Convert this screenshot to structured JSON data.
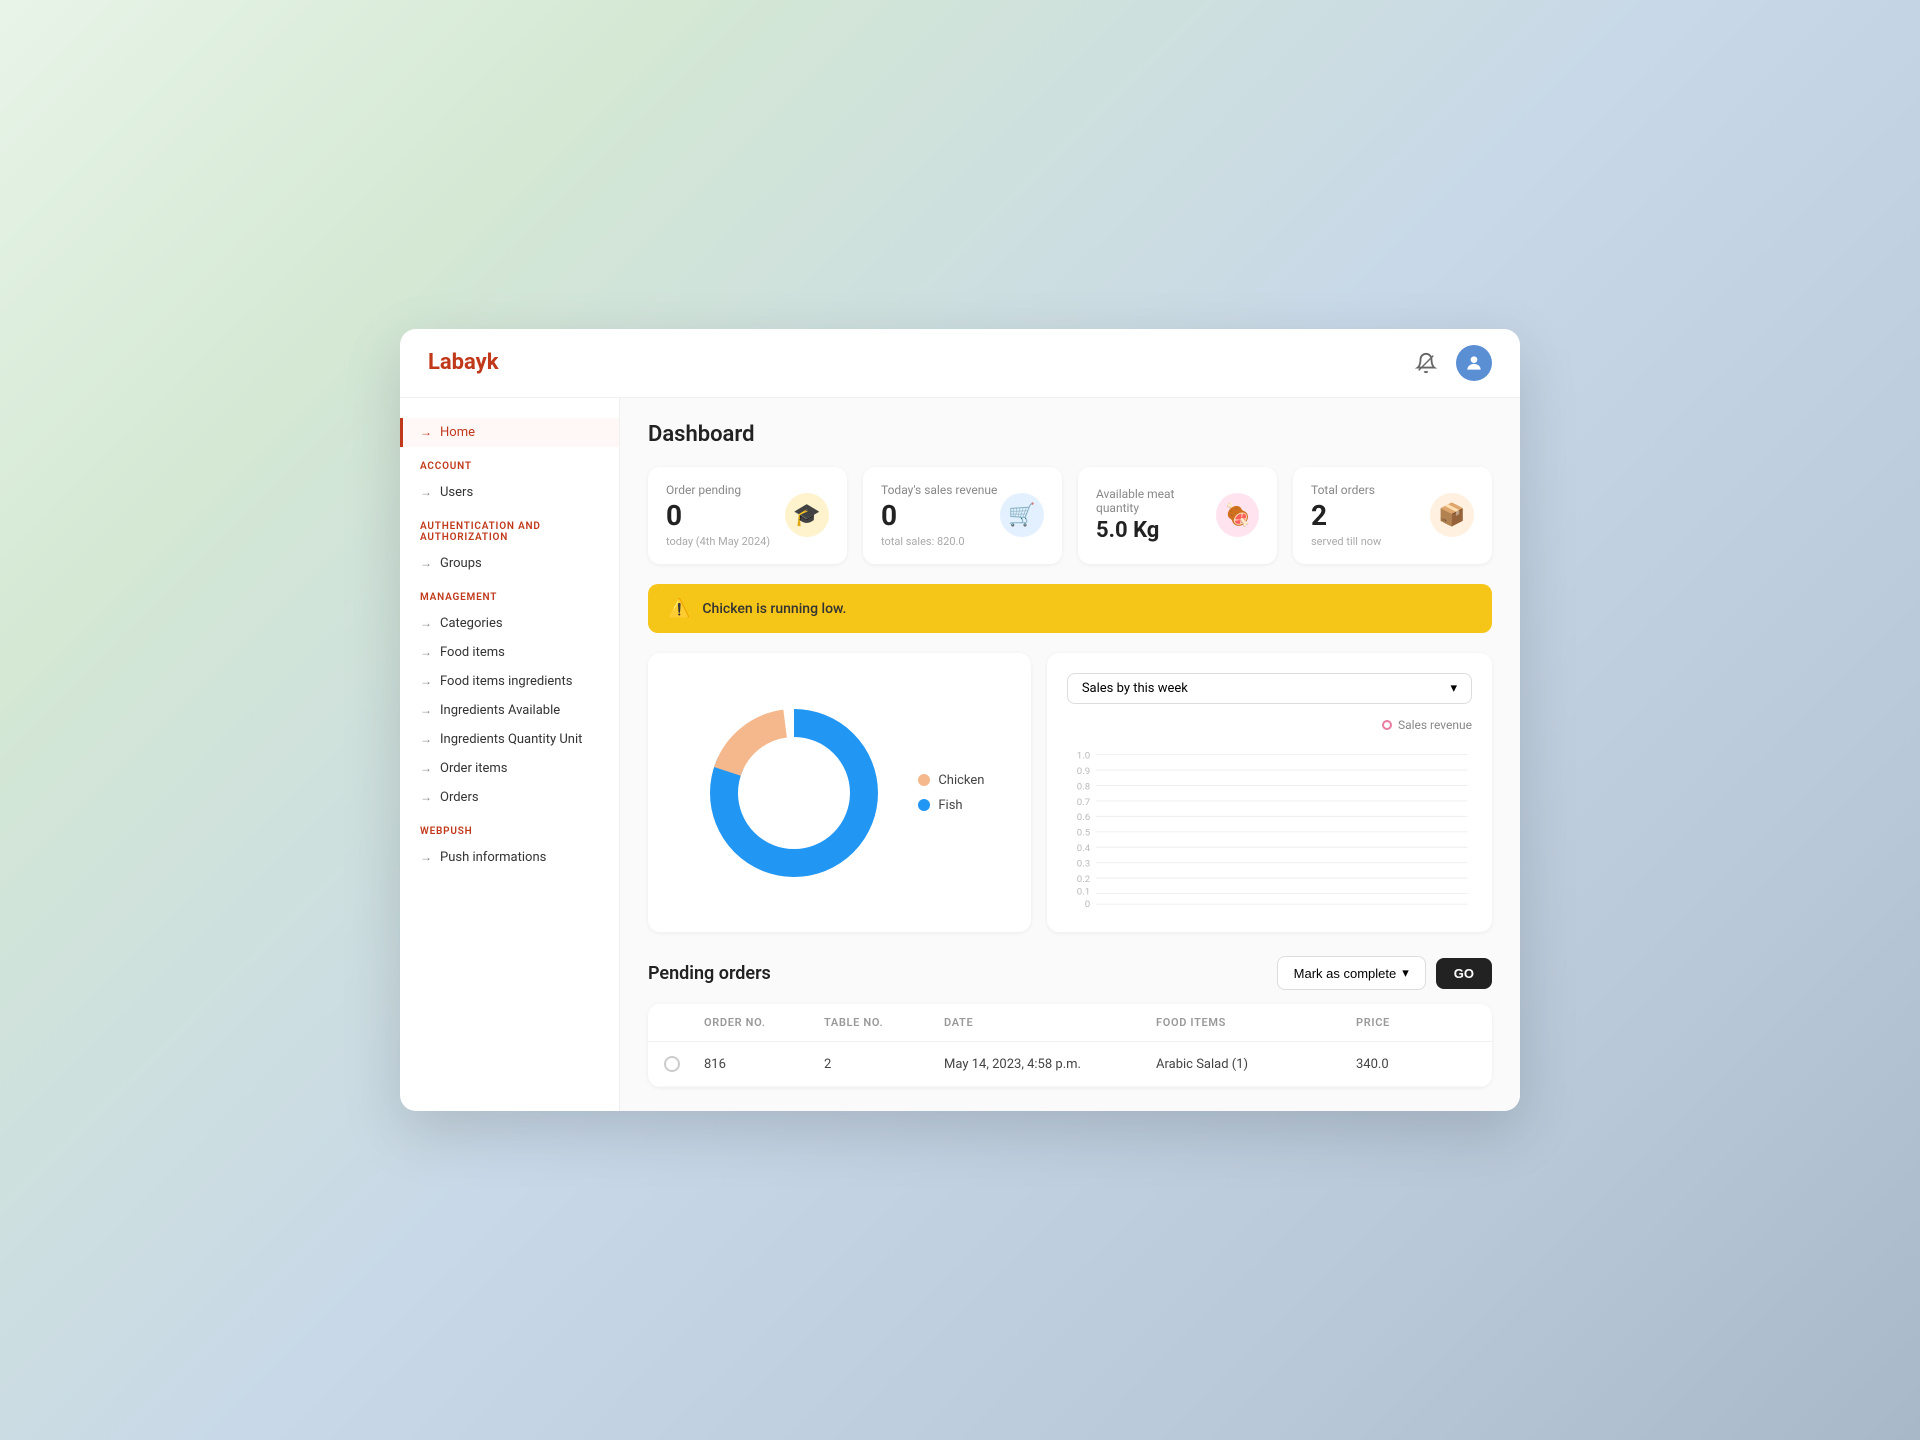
{
  "app": {
    "logo": "Labayk"
  },
  "header": {
    "notification_label": "notifications",
    "avatar_label": "user avatar"
  },
  "sidebar": {
    "sections": [
      {
        "label": "",
        "items": [
          {
            "id": "home",
            "label": "Home",
            "active": true
          }
        ]
      },
      {
        "label": "ACCOUNT",
        "items": [
          {
            "id": "users",
            "label": "Users"
          }
        ]
      },
      {
        "label": "AUTHENTICATION AND AUTHORIZATION",
        "items": [
          {
            "id": "groups",
            "label": "Groups"
          }
        ]
      },
      {
        "label": "MANAGEMENT",
        "items": [
          {
            "id": "categories",
            "label": "Categories"
          },
          {
            "id": "food-items",
            "label": "Food items"
          },
          {
            "id": "food-items-ingredients",
            "label": "Food items ingredients"
          },
          {
            "id": "ingredients-available",
            "label": "Ingredients Available"
          },
          {
            "id": "ingredients-quantity-unit",
            "label": "Ingredients Quantity Unit"
          },
          {
            "id": "order-items",
            "label": "Order items"
          },
          {
            "id": "orders",
            "label": "Orders"
          }
        ]
      },
      {
        "label": "WEBPUSH",
        "items": [
          {
            "id": "push-informations",
            "label": "Push informations"
          }
        ]
      }
    ]
  },
  "page": {
    "title": "Dashboard"
  },
  "stats": [
    {
      "id": "order-pending",
      "label": "Order pending",
      "value": "0",
      "sub": "today (4th May 2024)",
      "icon": "🎓",
      "icon_class": "yellow"
    },
    {
      "id": "sales-revenue",
      "label": "Today's sales revenue",
      "value": "0",
      "sub": "total sales: 820.0",
      "icon": "🛒",
      "icon_class": "blue"
    },
    {
      "id": "meat-quantity",
      "label": "Available meat quantity",
      "value": "5.0 Kg",
      "sub": "",
      "icon": "🍖",
      "icon_class": "pink"
    },
    {
      "id": "total-orders",
      "label": "Total orders",
      "value": "2",
      "sub": "served till now",
      "icon": "📦",
      "icon_class": "orange"
    }
  ],
  "alert": {
    "message": "Chicken is running low."
  },
  "donut_chart": {
    "segments": [
      {
        "label": "Chicken",
        "color": "#f5b88c",
        "percentage": 18
      },
      {
        "label": "Fish",
        "color": "#2196F3",
        "percentage": 82
      }
    ]
  },
  "sales_chart": {
    "dropdown_label": "Sales by this week",
    "legend_label": "Sales revenue",
    "y_labels": [
      "1.0",
      "0.9",
      "0.8",
      "0.7",
      "0.6",
      "0.5",
      "0.4",
      "0.3",
      "0.2",
      "0.1",
      "0"
    ],
    "data_points": []
  },
  "pending_orders": {
    "title": "Pending orders",
    "mark_complete_label": "Mark as complete",
    "go_label": "GO",
    "table": {
      "headers": [
        "",
        "ORDER NO.",
        "TABLE NO.",
        "DATE",
        "FOOD ITEMS",
        "PRICE"
      ],
      "rows": [
        {
          "order_no": "816",
          "table_no": "2",
          "date": "May 14, 2023, 4:58 p.m.",
          "food_items": "Arabic Salad (1)",
          "price": "340.0"
        }
      ]
    }
  }
}
